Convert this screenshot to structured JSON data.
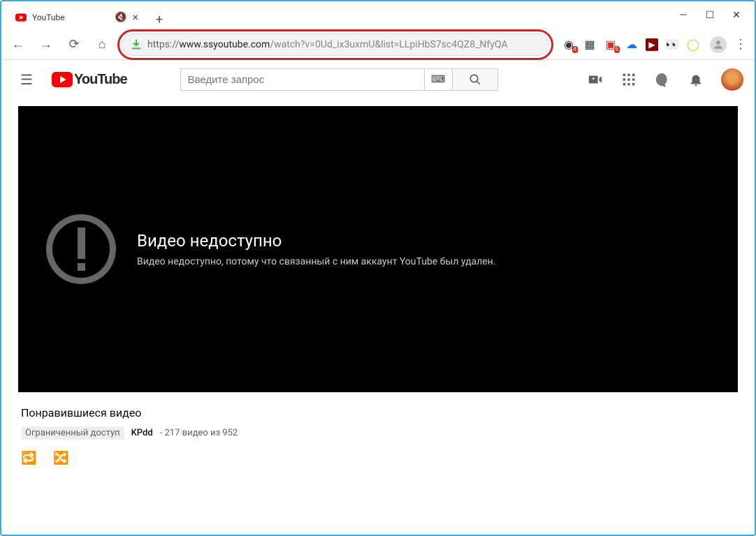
{
  "browser": {
    "tab_title": "YouTube",
    "url": {
      "protocol": "https://",
      "host": "www.ssyoutube.com",
      "path": "/watch?v=0Ud_ix3uxmU&list=LLpiHbS7sc4QZ8_NfyQA"
    },
    "extension_badges": {
      "ext1": "4",
      "ext2": "6"
    }
  },
  "youtube": {
    "logo_text": "YouTube",
    "search_placeholder": "Введите запрос",
    "error": {
      "title": "Видео недоступно",
      "message": "Видео недоступно, потому что связанный с ним аккаунт YouTube был удален."
    },
    "playlist": {
      "title": "Понравившиеся видео",
      "access": "Ограниченный доступ",
      "owner": "KPdd",
      "count_text": "217 видео из 952"
    }
  }
}
